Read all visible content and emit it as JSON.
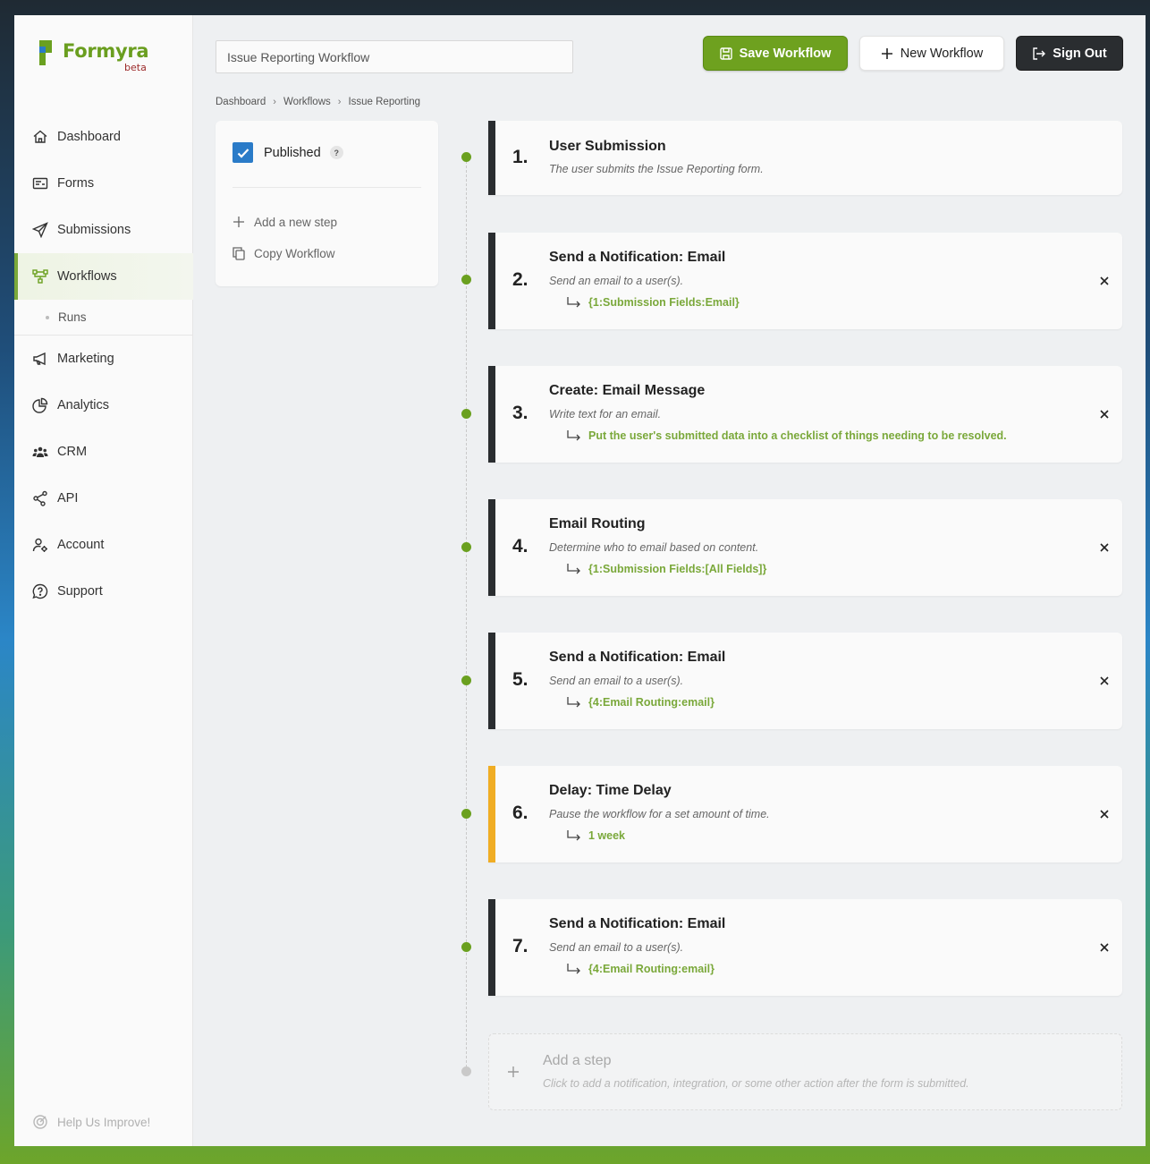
{
  "brand": {
    "name": "Formyra",
    "tag": "beta",
    "accent": "#6ea11f"
  },
  "sidebar": {
    "items": [
      {
        "label": "Dashboard",
        "icon": "home-icon"
      },
      {
        "label": "Forms",
        "icon": "forms-icon"
      },
      {
        "label": "Submissions",
        "icon": "paper-plane-icon"
      },
      {
        "label": "Workflows",
        "icon": "workflow-icon",
        "active": true
      },
      {
        "label": "Runs",
        "icon": "dot-icon"
      },
      {
        "label": "Marketing",
        "icon": "megaphone-icon"
      },
      {
        "label": "Analytics",
        "icon": "pie-chart-icon"
      },
      {
        "label": "CRM",
        "icon": "users-icon"
      },
      {
        "label": "API",
        "icon": "share-nodes-icon"
      },
      {
        "label": "Account",
        "icon": "user-gear-icon"
      },
      {
        "label": "Support",
        "icon": "question-bubble-icon"
      }
    ],
    "help": "Help Us Improve!"
  },
  "header": {
    "workflow_name": "Issue Reporting Workflow",
    "save_label": "Save Workflow",
    "new_label": "New Workflow",
    "signout_label": "Sign Out"
  },
  "breadcrumb": [
    "Dashboard",
    "Workflows",
    "Issue Reporting"
  ],
  "options": {
    "published_label": "Published",
    "published": true,
    "help_mark": "?",
    "add_step_label": "Add a new step",
    "copy_label": "Copy Workflow"
  },
  "steps": [
    {
      "num": "1.",
      "title": "User Submission",
      "desc": "The user submits the Issue Reporting form.",
      "link": ""
    },
    {
      "num": "2.",
      "title": "Send a Notification: Email",
      "desc": "Send an email to a user(s).",
      "link": "{1:Submission Fields:Email}"
    },
    {
      "num": "3.",
      "title": "Create: Email Message",
      "desc": "Write text for an email.",
      "link": "Put the user's submitted data into a checklist of things needing to be resolved."
    },
    {
      "num": "4.",
      "title": "Email Routing",
      "desc": "Determine who to email based on content.",
      "link": "{1:Submission Fields:[All Fields]}"
    },
    {
      "num": "5.",
      "title": "Send a Notification: Email",
      "desc": "Send an email to a user(s).",
      "link": "{4:Email Routing:email}"
    },
    {
      "num": "6.",
      "title": "Delay: Time Delay",
      "desc": "Pause the workflow for a set amount of time.",
      "link": "1 week"
    },
    {
      "num": "7.",
      "title": "Send a Notification: Email",
      "desc": "Send an email to a user(s).",
      "link": "{4:Email Routing:email}"
    }
  ],
  "add_step": {
    "title": "Add a step",
    "desc": "Click to add a notification, integration, or some other action after the form is submitted."
  }
}
